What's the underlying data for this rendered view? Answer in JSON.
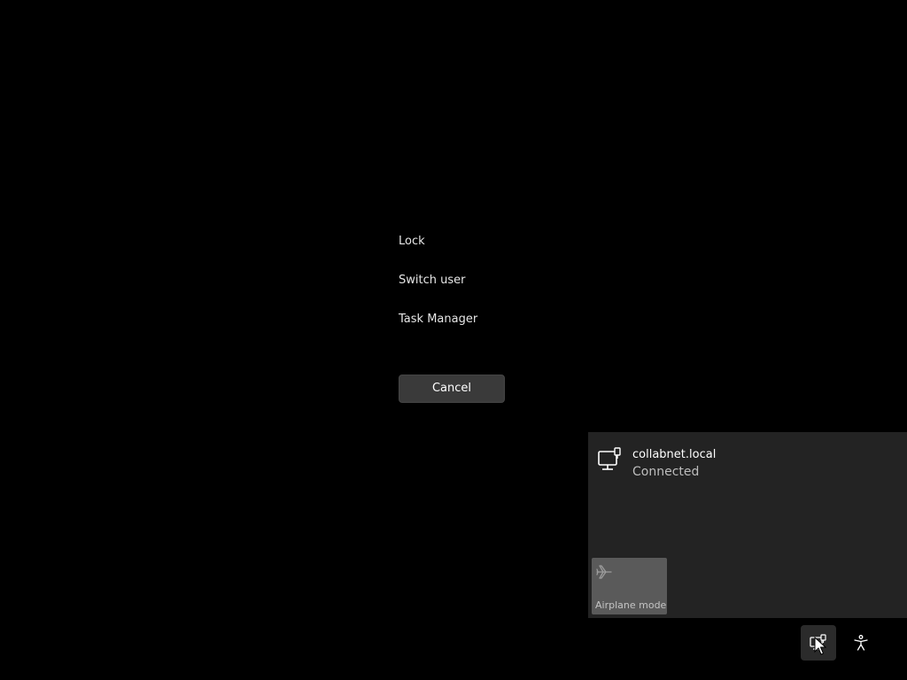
{
  "security_menu": {
    "items": [
      {
        "label": "Lock"
      },
      {
        "label": "Switch user"
      },
      {
        "label": "Task Manager"
      }
    ],
    "cancel_label": "Cancel"
  },
  "network_flyout": {
    "network": {
      "name": "collabnet.local",
      "status": "Connected",
      "icon": "wired-network-icon"
    },
    "airplane_mode": {
      "label": "Airplane mode",
      "icon": "airplane-icon",
      "state": "off"
    }
  },
  "tray": {
    "network_icon": "network-icon",
    "accessibility_icon": "accessibility-icon"
  },
  "colors": {
    "background": "#000000",
    "flyout_bg": "#232323",
    "tile_bg": "#5a5a5a",
    "button_bg": "#3a3a3a"
  }
}
